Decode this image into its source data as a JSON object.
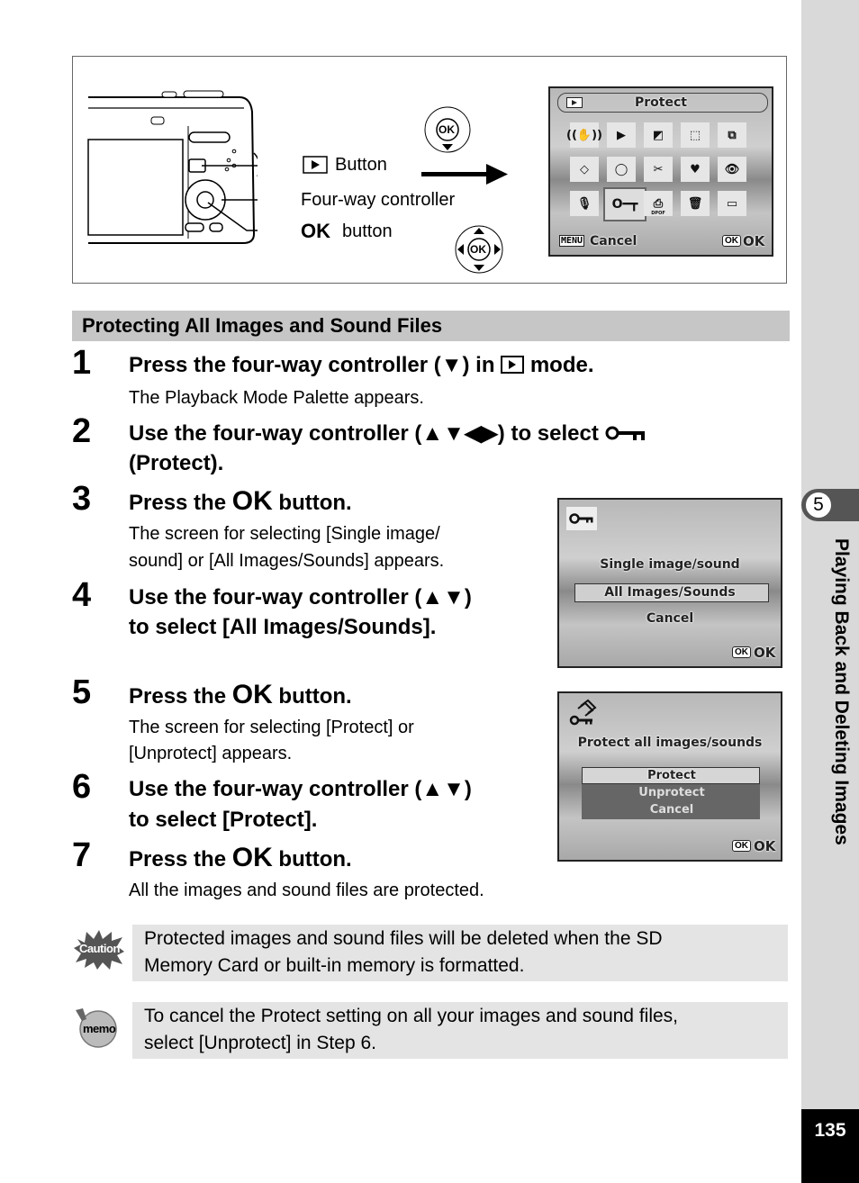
{
  "figure": {
    "labels": {
      "playback_button": "Button",
      "four_way": "Four-way controller",
      "ok_prefix": "OK",
      "ok_button": "button"
    },
    "ok_glyph": "OK",
    "palette_screen": {
      "title": "Protect",
      "menu_key": "MENU",
      "cancel": "Cancel",
      "ok_key": "OK",
      "ok": "OK",
      "dpof_label": "DPOF",
      "icons": [
        "slideshow-icon",
        "playback-icon",
        "resize-icon",
        "cropping-icon",
        "copy-icon",
        "rotate-icon",
        "filter-icon",
        "movie-edit-icon",
        "frame-icon",
        "red-eye-icon",
        "voice-memo-icon",
        "protect-icon",
        "dpof-icon",
        "recover-icon",
        "start-screen-icon"
      ],
      "selected_icon": "protect-icon"
    }
  },
  "section": {
    "title": "Protecting All Images and Sound Files"
  },
  "steps": [
    {
      "num": "1",
      "title_a": "Press the four-way controller (▼) in",
      "title_b": "mode.",
      "desc": "The Playback Mode Palette appears."
    },
    {
      "num": "2",
      "title_a": "Use the four-way controller (▲▼◀▶) to select",
      "title_b": "(Protect)."
    },
    {
      "num": "3",
      "title_a": "Press the",
      "ok": "OK",
      "title_b": "button.",
      "desc1": "The screen for selecting [Single image/",
      "desc2": "sound] or [All Images/Sounds] appears."
    },
    {
      "num": "4",
      "title1": "Use the four-way controller (▲▼)",
      "title2": "to select [All Images/Sounds]."
    },
    {
      "num": "5",
      "title_a": "Press the",
      "ok": "OK",
      "title_b": "button.",
      "desc1": "The screen for selecting [Protect] or",
      "desc2": "[Unprotect] appears."
    },
    {
      "num": "6",
      "title1": "Use the four-way controller (▲▼)",
      "title2": "to select [Protect]."
    },
    {
      "num": "7",
      "title_a": "Press the",
      "ok": "OK",
      "title_b": "button.",
      "desc": "All the images and sound files are protected."
    }
  ],
  "screen_select": {
    "options": [
      "Single image/sound",
      "All Images/Sounds",
      "Cancel"
    ],
    "selected": "All Images/Sounds",
    "ok_key": "OK",
    "ok": "OK"
  },
  "screen_protect": {
    "title": "Protect all images/sounds",
    "options": [
      "Protect",
      "Unprotect",
      "Cancel"
    ],
    "selected": "Protect",
    "ok_key": "OK",
    "ok": "OK"
  },
  "notes": {
    "caution_icon_label": "Caution",
    "caution_line1": "Protected images and sound files will be deleted when the SD",
    "caution_line2": "Memory Card or built-in memory is formatted.",
    "memo_icon_label": "memo",
    "memo_line1": "To cancel the Protect setting on all your images and sound files,",
    "memo_line2": "select [Unprotect] in Step 6."
  },
  "sidebar": {
    "chapter_number": "5",
    "chapter_title": "Playing Back and Deleting Images",
    "page_number": "135"
  }
}
